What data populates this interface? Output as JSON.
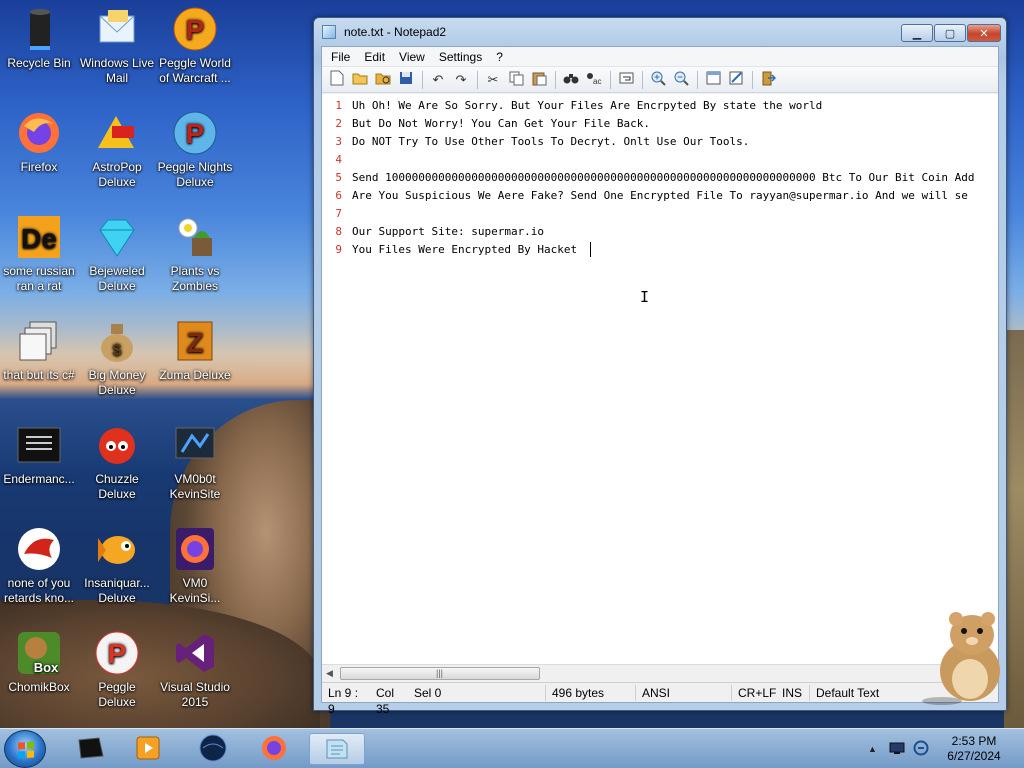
{
  "desktop": {
    "icons": [
      {
        "label": "Recycle Bin",
        "icon": "recycle-bin-icon"
      },
      {
        "label": "Windows Live Mail",
        "icon": "mail-icon"
      },
      {
        "label": "Peggle World of Warcraft ...",
        "icon": "peggle-icon"
      },
      {
        "label": "Firefox",
        "icon": "firefox-icon"
      },
      {
        "label": "AstroPop Deluxe",
        "icon": "astropop-icon"
      },
      {
        "label": "Peggle Nights Deluxe",
        "icon": "peggle-nights-icon"
      },
      {
        "label": "some russian ran a rat",
        "icon": "de-app-icon"
      },
      {
        "label": "Bejeweled Deluxe",
        "icon": "gem-icon"
      },
      {
        "label": "Plants vs Zombies",
        "icon": "plants-icon"
      },
      {
        "label": "that but its c#",
        "icon": "windows-stack-icon"
      },
      {
        "label": "Big Money Deluxe",
        "icon": "money-bag-icon"
      },
      {
        "label": "Zuma Deluxe",
        "icon": "zuma-icon"
      },
      {
        "label": "Endermanc...",
        "icon": "terminal-icon"
      },
      {
        "label": "Chuzzle Deluxe",
        "icon": "chuzzle-icon"
      },
      {
        "label": "VM0b0t KevinSite",
        "icon": "vm-icon"
      },
      {
        "label": "none of you retards kno...",
        "icon": "red-dragon-icon"
      },
      {
        "label": "Insaniquar... Deluxe",
        "icon": "fish-icon"
      },
      {
        "label": "VM0 KevinSi...",
        "icon": "firefox-shortcut-icon"
      },
      {
        "label": "ChomikBox",
        "icon": "chomikbox-icon"
      },
      {
        "label": "Peggle Deluxe",
        "icon": "peggle-deluxe-icon"
      },
      {
        "label": "Visual Studio 2015",
        "icon": "visual-studio-icon"
      }
    ]
  },
  "window": {
    "title": "note.txt - Notepad2",
    "menu": [
      "File",
      "Edit",
      "View",
      "Settings",
      "?"
    ],
    "toolbar_icons": [
      "new-icon",
      "open-icon",
      "browse-icon",
      "save-icon",
      "undo-icon",
      "redo-icon",
      "cut-icon",
      "copy-icon",
      "paste-icon",
      "find-icon",
      "replace-icon",
      "wordwrap-icon",
      "zoom-in-icon",
      "zoom-out-icon",
      "scheme-icon",
      "customize-icon",
      "exit-icon"
    ],
    "lines": [
      {
        "n": "1",
        "text": "Uh Oh! We Are So Sorry. But Your Files Are Encrpyted By state the world"
      },
      {
        "n": "2",
        "text": "But Do Not Worry! You Can Get Your File Back."
      },
      {
        "n": "3",
        "text": "Do NOT Try To Use Other Tools To Decryt. Onlt Use Our Tools."
      },
      {
        "n": "4",
        "text": ""
      },
      {
        "n": "5",
        "text": "Send 10000000000000000000000000000000000000000000000000000000000000000 Btc To Our Bit Coin Add"
      },
      {
        "n": "6",
        "text": "Are You Suspicious We Aere Fake? Send One Encrypted File To rayyan@supermar.io And we will se"
      },
      {
        "n": "7",
        "text": ""
      },
      {
        "n": "8",
        "text": "Our Support Site: supermar.io"
      },
      {
        "n": "9",
        "text": "You Files Were Encrypted By Hacket"
      }
    ],
    "status": {
      "position": "Ln 9 : 9",
      "col": "Col 35",
      "sel": "Sel 0",
      "size": "496 bytes",
      "encoding": "ANSI",
      "eol": "CR+LF",
      "mode": "INS",
      "scheme": "Default Text"
    }
  },
  "taskbar": {
    "items": [
      "start-button",
      "black-app-icon",
      "media-player-icon",
      "globe-icon",
      "firefox-icon",
      "notepad2-icon"
    ],
    "clock_time": "2:53 PM",
    "clock_date": "6/27/2024"
  },
  "colors": {
    "line_number": "#d0312d",
    "accent": "#2a73c8"
  }
}
